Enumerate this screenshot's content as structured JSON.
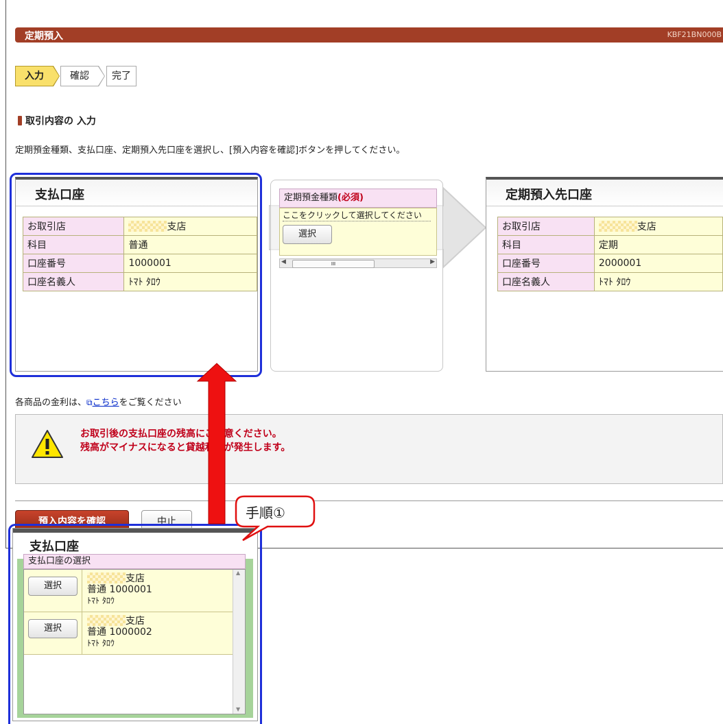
{
  "header": {
    "title": "定期預入",
    "screen_code": "KBF21BN000B"
  },
  "steps": [
    "入力",
    "確認",
    "完了"
  ],
  "section_title": "取引内容の 入力",
  "instruction": "定期預金種類、支払口座、定期預入先口座を選択し、[預入内容を確認]ボタンを押してください。",
  "payment_account": {
    "title": "支払口座",
    "rows": [
      {
        "label": "お取引店",
        "value": "支店"
      },
      {
        "label": "科目",
        "value": "普通"
      },
      {
        "label": "口座番号",
        "value": "1000001"
      },
      {
        "label": "口座名義人",
        "value": "ﾄﾏﾄ ﾀﾛｳ"
      }
    ]
  },
  "deposit_type": {
    "label": "定期預金種類",
    "required": "(必須)",
    "placeholder": "ここをクリックして選択してください",
    "select_button": "選択",
    "scroll_glyph": "III"
  },
  "deposit_account": {
    "title": "定期預入先口座",
    "rows": [
      {
        "label": "お取引店",
        "value": "支店"
      },
      {
        "label": "科目",
        "value": "定期"
      },
      {
        "label": "口座番号",
        "value": "2000001"
      },
      {
        "label": "口座名義人",
        "value": "ﾄﾏﾄ ﾀﾛｳ"
      }
    ]
  },
  "rate_note": {
    "prefix": "各商品の金利は、",
    "link": "こちら",
    "suffix": "をご覧ください"
  },
  "warning": {
    "line1": "お取引後の支払口座の残高にご注意ください。",
    "line2": "残高がマイナスになると貸越利息が発生します。"
  },
  "buttons": {
    "confirm": "預入内容を確認",
    "cancel": "中止"
  },
  "callout": "手順①",
  "popup": {
    "title": "支払口座",
    "list_header": "支払口座の選択",
    "items": [
      {
        "button": "選択",
        "branch": "支店",
        "account": "普通 1000001",
        "holder": "ﾄﾏﾄ ﾀﾛｳ"
      },
      {
        "button": "選択",
        "branch": "支店",
        "account": "普通 1000002",
        "holder": "ﾄﾏﾄ ﾀﾛｳ"
      }
    ]
  },
  "colors": {
    "brand": "#a23e26",
    "highlight": "#1e2fd9",
    "arrow": "#ee1111",
    "warning_text": "#c0001a"
  }
}
